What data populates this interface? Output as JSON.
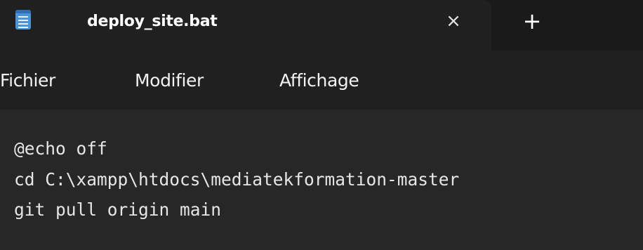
{
  "tab": {
    "icon": "notepad-file-icon",
    "title": "deploy_site.bat",
    "close_glyph": "×",
    "new_tab_glyph": "+"
  },
  "menu": {
    "items": [
      {
        "label": "Fichier"
      },
      {
        "label": "Modifier"
      },
      {
        "label": "Affichage"
      }
    ]
  },
  "editor": {
    "lines": [
      "@echo off",
      "cd C:\\xampp\\htdocs\\mediatekformation-master",
      "git pull origin main"
    ]
  },
  "colors": {
    "background": "#202020",
    "editor_background": "#272727",
    "icon_accent": "#4c94d8"
  }
}
